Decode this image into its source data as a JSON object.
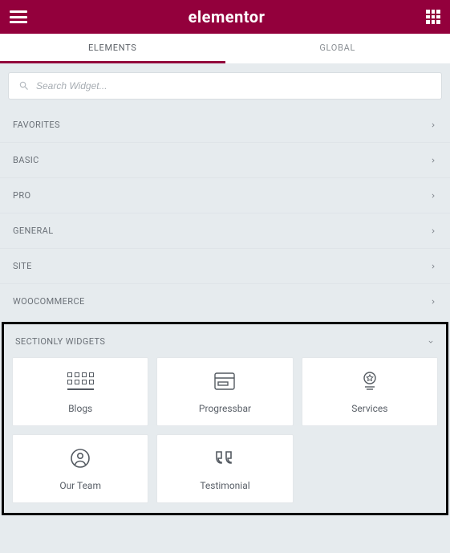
{
  "header": {
    "brand": "elementor"
  },
  "tabs": {
    "elements": "ELEMENTS",
    "global": "GLOBAL"
  },
  "search": {
    "placeholder": "Search Widget..."
  },
  "categories": {
    "favorites": "FAVORITES",
    "basic": "BASIC",
    "pro": "PRO",
    "general": "GENERAL",
    "site": "SITE",
    "woocommerce": "WOOCOMMERCE",
    "sectionly": "SECTIONLY WIDGETS"
  },
  "widgets": {
    "blogs": "Blogs",
    "progressbar": "Progressbar",
    "services": "Services",
    "ourteam": "Our Team",
    "testimonial": "Testimonial"
  }
}
